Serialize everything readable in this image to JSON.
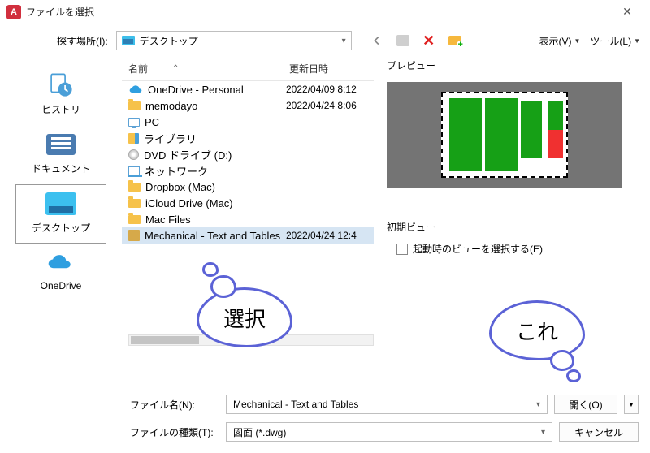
{
  "window": {
    "title": "ファイルを選択"
  },
  "toolbar": {
    "look_in_label": "探す場所(I):",
    "look_in_value": "デスクトップ",
    "view_label": "表示(V)",
    "tools_label": "ツール(L)"
  },
  "sidebar": {
    "items": [
      {
        "label": "ヒストリ"
      },
      {
        "label": "ドキュメント"
      },
      {
        "label": "デスクトップ"
      },
      {
        "label": "OneDrive"
      }
    ]
  },
  "file_header": {
    "name": "名前",
    "date": "更新日時"
  },
  "files": [
    {
      "name": "OneDrive - Personal",
      "date": "2022/04/09 8:12",
      "icon": "cloud"
    },
    {
      "name": "memodayo",
      "date": "2022/04/24 8:06",
      "icon": "folder"
    },
    {
      "name": "PC",
      "date": "",
      "icon": "pc"
    },
    {
      "name": "ライブラリ",
      "date": "",
      "icon": "lib"
    },
    {
      "name": "DVD ドライブ (D:)",
      "date": "",
      "icon": "dvd"
    },
    {
      "name": "ネットワーク",
      "date": "",
      "icon": "net"
    },
    {
      "name": "Dropbox (Mac)",
      "date": "",
      "icon": "folder"
    },
    {
      "name": "iCloud Drive (Mac)",
      "date": "",
      "icon": "folder"
    },
    {
      "name": "Mac Files",
      "date": "",
      "icon": "folder"
    },
    {
      "name": "Mechanical - Text and Tables",
      "date": "2022/04/24 12:4",
      "icon": "dwg",
      "selected": true
    }
  ],
  "preview": {
    "label": "プレビュー"
  },
  "initial_view": {
    "label": "初期ビュー",
    "checkbox_label": "起動時のビューを選択する(E)"
  },
  "bottom": {
    "filename_label": "ファイル名(N):",
    "filename_value": "Mechanical - Text and Tables",
    "filetype_label": "ファイルの種類(T):",
    "filetype_value": "図面 (*.dwg)",
    "open_label": "開く(O)",
    "cancel_label": "キャンセル"
  },
  "annotations": {
    "select": "選択",
    "this": "これ"
  }
}
